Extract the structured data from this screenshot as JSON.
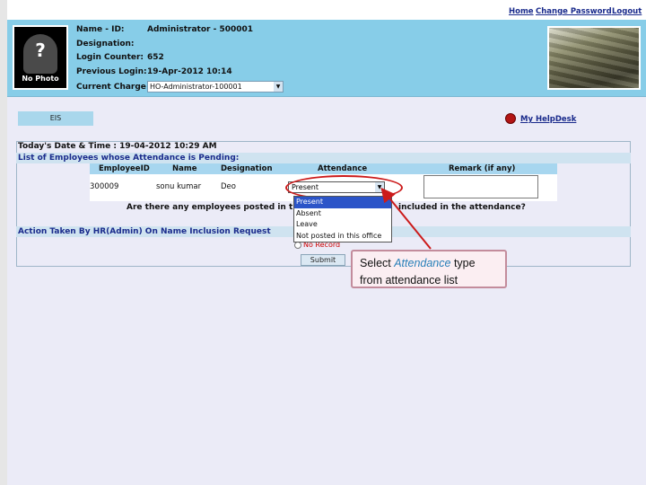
{
  "topnav": {
    "home": "Home",
    "change_password": "Change Password",
    "logout": "Logout"
  },
  "header": {
    "photo_text": "No Photo",
    "photo_glyph": "?",
    "fields": [
      {
        "label": "Name - ID:",
        "value": "Administrator - 500001"
      },
      {
        "label": "Designation:",
        "value": ""
      },
      {
        "label": "Login Counter:",
        "value": "652"
      },
      {
        "label": "Previous Login:",
        "value": "19-Apr-2012 10:14"
      },
      {
        "label": "Current Charge",
        "value": "HO-Administrator-100001"
      }
    ]
  },
  "eis_tab": "EIS",
  "helpdesk": "My HelpDesk",
  "datetime": "Today's Date & Time : 19-04-2012 10:29 AM",
  "pending_heading": "List of Employees whose Attendance is Pending:",
  "table": {
    "headers": [
      "EmployeeID",
      "Name",
      "Designation",
      "Attendance",
      "Remark (if any)"
    ],
    "rows": [
      {
        "employee_id": "300009",
        "name": "sonu kumar",
        "designation": "Deo",
        "attendance": "Present",
        "remark": ""
      }
    ]
  },
  "question_left": "Are there any employees posted in this",
  "question_right": "included in the attendance?",
  "attendance_options": [
    "Present",
    "Absent",
    "Leave",
    "Not posted in this office"
  ],
  "action_heading": "Action Taken By HR(Admin) On Name Inclusion Request",
  "radio_label": "No Record",
  "submit_label": "Submit",
  "callout": {
    "prefix": "Select ",
    "highlight": "Attendance",
    "suffix": " type",
    "line2": "from attendance list"
  },
  "colors": {
    "header_bg": "#87cde8",
    "link": "#1a2b8c",
    "annotation_red": "#cc1b1b",
    "callout_bg": "#fbeef2"
  }
}
